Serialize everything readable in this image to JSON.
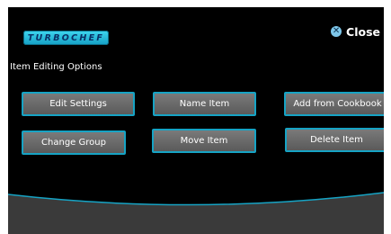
{
  "header": {
    "logo_text": "TURBOCHEF",
    "close_label": "Close"
  },
  "section": {
    "title": "Item Editing Options"
  },
  "buttons": {
    "edit_settings": "Edit Settings",
    "name_item": "Name Item",
    "add_from_cookbook": "Add from Cookbook",
    "change_group": "Change Group",
    "move_item": "Move Item",
    "delete_item": "Delete Item"
  },
  "colors": {
    "background": "#000000",
    "button_border": "#16a3c4",
    "button_fill": "#6a6a6a",
    "logo": "#2bbfe0",
    "close_icon": "#7ec7ea",
    "bottom_bar": "#3a3a3a"
  },
  "icons": {
    "close": "close-circle-icon"
  }
}
